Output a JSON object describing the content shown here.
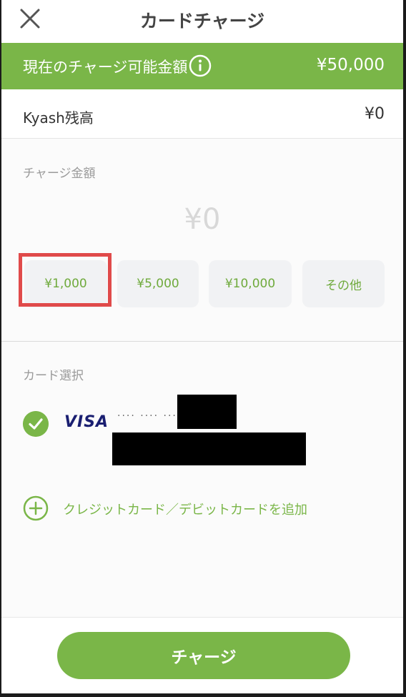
{
  "header": {
    "title": "カードチャージ",
    "close_icon": "close-icon"
  },
  "limit": {
    "label": "現在のチャージ可能金額",
    "value": "¥50,000",
    "info_icon": "info-icon"
  },
  "balance": {
    "label": "Kyash残高",
    "value": "¥0"
  },
  "amount": {
    "section_label": "チャージ金額",
    "display": "¥0",
    "presets": [
      {
        "label": "¥1,000",
        "selected": true
      },
      {
        "label": "¥5,000",
        "selected": false
      },
      {
        "label": "¥10,000",
        "selected": false
      },
      {
        "label": "その他",
        "selected": false
      }
    ]
  },
  "card": {
    "section_label": "カード選択",
    "brand": "VISA",
    "masked_number": "···· ···· ····",
    "add_label": "クレジットカード／デビットカードを追加"
  },
  "footer": {
    "button_label": "チャージ"
  },
  "colors": {
    "accent": "#7ab648",
    "highlight": "#e04a4a",
    "visa": "#1a1f71"
  }
}
